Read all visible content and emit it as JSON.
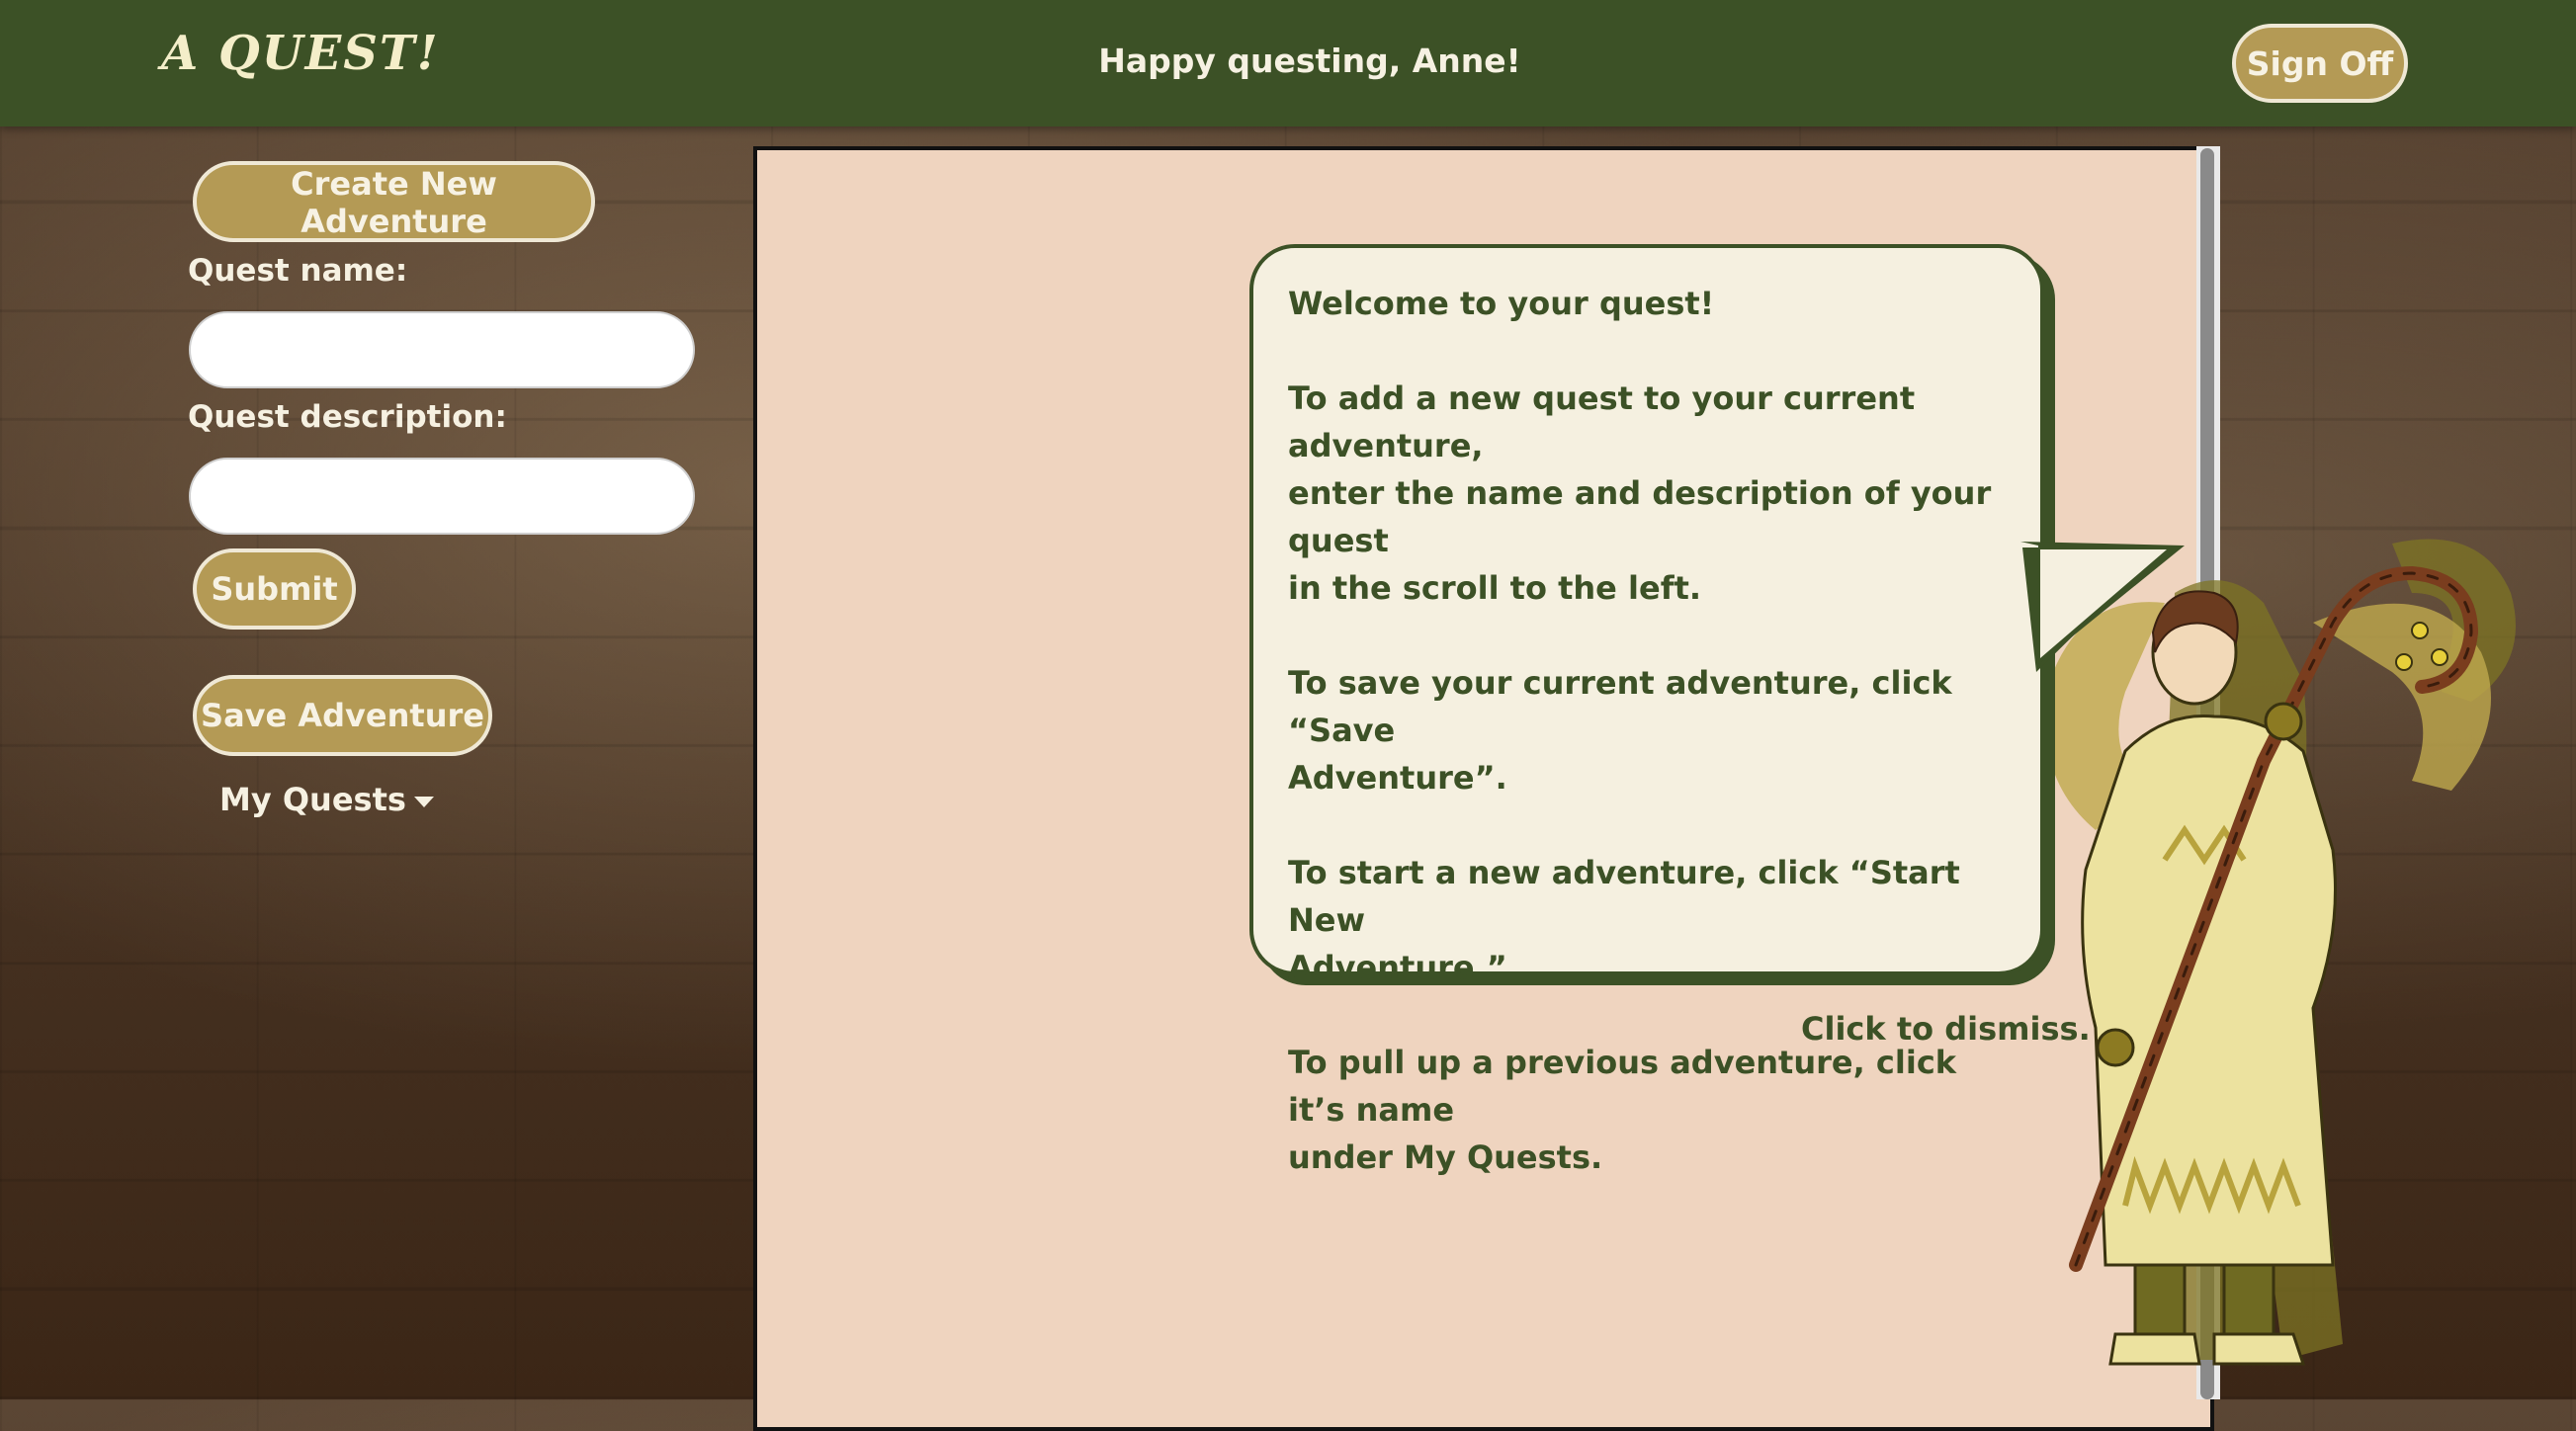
{
  "header": {
    "brand": "A QUEST!",
    "greeting": "Happy questing, Anne!",
    "sign_off_label": "Sign Off"
  },
  "form": {
    "create_label": "Create New Adventure",
    "quest_name_label": "Quest name:",
    "quest_name_value": "",
    "quest_description_label": "Quest description:",
    "quest_description_value": "",
    "submit_label": "Submit",
    "save_label": "Save Adventure",
    "my_quests_label": "My Quests"
  },
  "welcome": {
    "paragraphs": [
      "Welcome to your quest!",
      "To add a new quest to your current adventure,\nenter the name and description of your quest\nin the scroll to the left.",
      "To save your current adventure, click “Save\nAdventure”.",
      "To start a new adventure, click “Start New\nAdventure.”",
      "To pull up a previous adventure, click it’s name\nunder My Quests."
    ],
    "dismiss_label": "Click to dismiss."
  },
  "colors": {
    "header_green": "#3c5126",
    "button_gold": "#b49a55",
    "scroll_paper": "#efd4bf",
    "bubble_fill": "#f5f0e0"
  }
}
